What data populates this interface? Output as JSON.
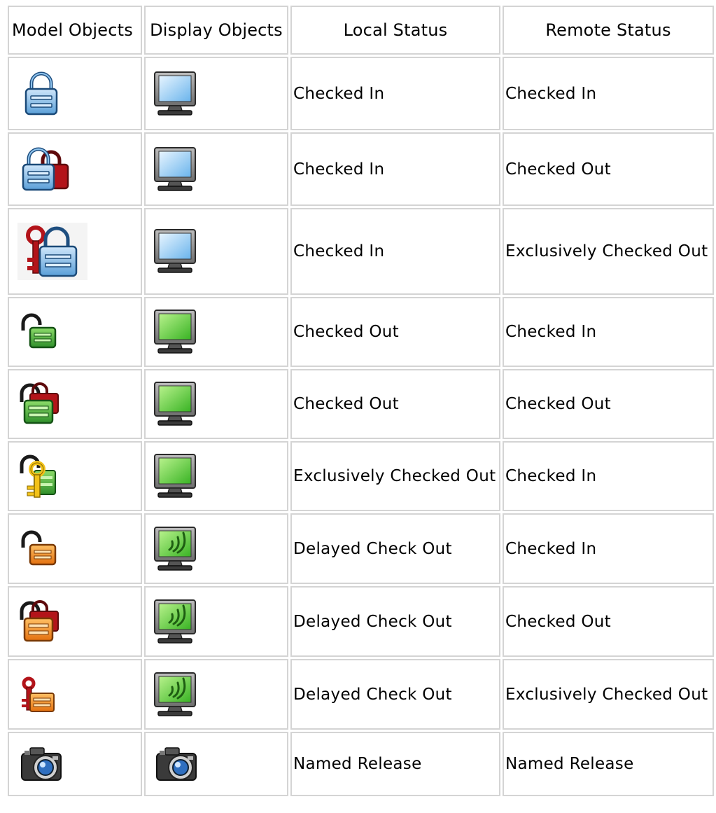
{
  "columns": [
    "Model Objects",
    "Display Objects",
    "Local Status",
    "Remote Status"
  ],
  "rows": [
    {
      "model_icon": "lock-closed-blue-icon",
      "display_icon": "monitor-blue-icon",
      "local": "Checked In",
      "remote": "Checked In"
    },
    {
      "model_icon": "lock-closed-blue-with-red-lock-icon",
      "display_icon": "monitor-blue-icon",
      "local": "Checked In",
      "remote": "Checked Out"
    },
    {
      "model_icon": "lock-closed-blue-with-red-key-icon",
      "display_icon": "monitor-blue-icon",
      "local": "Checked In",
      "remote": "Exclusively Checked Out"
    },
    {
      "model_icon": "lock-open-green-icon",
      "display_icon": "monitor-green-icon",
      "local": "Checked Out",
      "remote": "Checked In"
    },
    {
      "model_icon": "lock-open-green-with-red-lock-icon",
      "display_icon": "monitor-green-icon",
      "local": "Checked Out",
      "remote": "Checked Out"
    },
    {
      "model_icon": "lock-green-with-yellow-key-icon",
      "display_icon": "monitor-green-icon",
      "local": "Exclusively Checked Out",
      "remote": "Checked In"
    },
    {
      "model_icon": "lock-open-orange-icon",
      "display_icon": "monitor-green-signal-icon",
      "local": "Delayed Check Out",
      "remote": "Checked In"
    },
    {
      "model_icon": "lock-open-orange-with-red-lock-icon",
      "display_icon": "monitor-green-signal-icon",
      "local": "Delayed Check Out",
      "remote": "Checked Out"
    },
    {
      "model_icon": "lock-orange-with-red-key-icon",
      "display_icon": "monitor-green-signal-icon",
      "local": "Delayed Check Out",
      "remote": "Exclusively Checked Out"
    },
    {
      "model_icon": "camera-icon",
      "display_icon": "camera-icon",
      "local": "Named Release",
      "remote": "Named Release"
    }
  ],
  "colors": {
    "blue_body": "#7cb8e8",
    "green_body": "#3fa83a",
    "orange_body": "#f08a1e",
    "red_lock": "#b3141a",
    "yellow_key": "#f2c21a",
    "border": "#d4d4d4"
  }
}
